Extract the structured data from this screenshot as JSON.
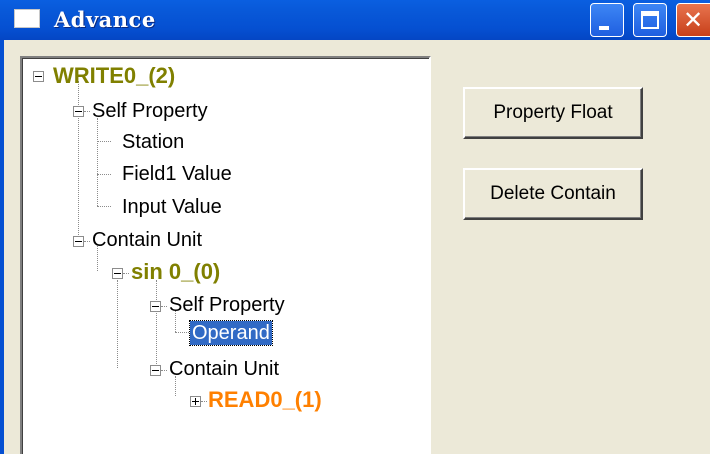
{
  "window": {
    "title": "Advance",
    "icon": "window-icon",
    "controls": {
      "minimize": "minimize-icon",
      "maximize": "maximize-icon",
      "close": "close-icon"
    }
  },
  "tree": {
    "root": "WRITE0_(2)",
    "root_self_property": "Self Property",
    "station": "Station",
    "field1_value": "Field1 Value",
    "input_value": "Input Value",
    "root_contain_unit": "Contain Unit",
    "sin_node": "sin 0_(0)",
    "sin_self_property": "Self Property",
    "operand": "Operand",
    "sin_contain_unit": "Contain Unit",
    "read_node": "READ0_(1)",
    "selected_node": "Operand",
    "colors": {
      "unit_node": "#808000",
      "leaf_unit_node": "#ff8000",
      "selection": "#316ac5"
    }
  },
  "buttons": {
    "property_float": "Property Float",
    "delete_contain": "Delete Contain"
  }
}
